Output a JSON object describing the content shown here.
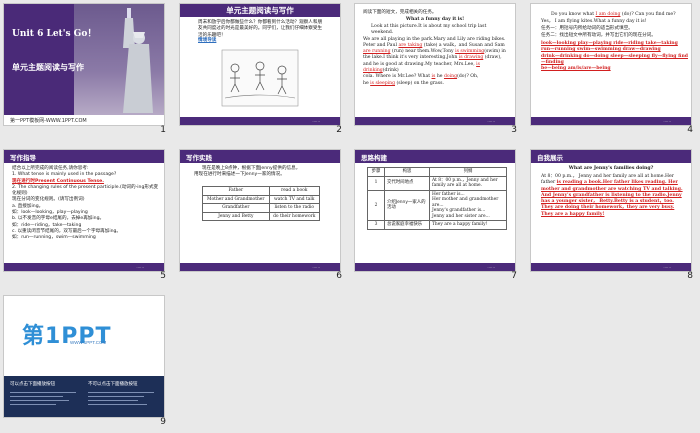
{
  "slide1": {
    "number": "1",
    "unit_title": "Unit 6 Let's Go！",
    "subtitle": "单元主题阅读与写作",
    "footer": "第一PPT模板网-WWW.1PPT.COM"
  },
  "slide2": {
    "number": "2",
    "band": "单元主题阅读与写作",
    "text": "周末和放学后你都做些什么？你都看到什么活动？观察人和朋友共同度过的时光是最美好的。同学们，让我们仔细体察受生活的乐趣吧！",
    "link": "情境导读"
  },
  "slide3": {
    "number": "3",
    "intro": "阅读下面的短文，完成相关的任务。",
    "title": "What a funny day it is!",
    "lines": [
      "Look at this picture.It is about my school trip last weekend.",
      "We are all playing in the park.Mary and Lily are riding bikes.",
      "Peter and Paul",
      "(take) a walk，and Susan and Sam",
      "(run) near them.Wow,Tony",
      "(swim) in",
      "the lake.I think it's very interesting.John",
      "(draw),",
      "and he is good at drawing.My teacher, Mrs.Lee,",
      "(drink)",
      "cola. Where is Mr.Lee? What",
      "he",
      "(do)? Oh,",
      "he",
      "(sleep) on the grass."
    ],
    "answers": [
      "are taking",
      "are running",
      "is swimming",
      "is drawing",
      "is drinking",
      "is",
      "doing",
      "is sleeping"
    ]
  },
  "slide4": {
    "number": "4",
    "q": "Do you know what",
    "ans": "I am doing",
    "q2": "(do)? Can you find me?",
    "l2": "Yes， I am flying kites.What a funny day it is!",
    "tasks": [
      "任务一：用括号内所给动词的适当形式填空。",
      "任务二：找出短文中所有动词，并写出它们的现在分词。"
    ],
    "red_lines": [
      "look—looking play—playing ride—riding take—taking",
      "run—running swim—swimming draw—drawing",
      "drink—drinking do—doing sleep—sleeping fly—flying find—finding",
      "be—being am/is/are—being"
    ]
  },
  "slide5": {
    "number": "5",
    "band": "写作指导",
    "l1": "结合以上所完成的阅读任务,请你思考:",
    "q1": "1. What tense is mainly used in the passage?",
    "a1": "现在进行时Present Continuous Tense.",
    "q2": "2. The changing rules of the present participle.(动词的-ing形式变化规则)",
    "q2b": "现在分词的变化规则。(请写出例词)",
    "r1": "a. 直接加ing。",
    "r1e": "如：look—looking，play—playing",
    "r2": "b. 以不发音的字母e结尾的，去掉e再加ing。",
    "r2e": "如：ride—riding，take—taking",
    "r3": "c. 以重读闭音节结尾的，双写最后一个字母再加ing。",
    "r3e": "如：run—running，swim—swimming"
  },
  "slide6": {
    "number": "6",
    "band": "写作实践",
    "l1": "现在是晚上8点钟，根据下面Jenny提供的信息，",
    "l2": "用现在进行时来描述一下Jenny一家的情况。",
    "rows": [
      [
        "Father",
        "read a book"
      ],
      [
        "Mother and Grandmother",
        "watch TV and talk"
      ],
      [
        "Grandfather",
        "listen to the radio"
      ],
      [
        "Jenny and Betty",
        "do their homework"
      ]
    ]
  },
  "slide7": {
    "number": "7",
    "band": "思路构建",
    "headers": [
      "步骤",
      "构思",
      "列纲"
    ],
    "rows": [
      [
        "1",
        "交代时间地点",
        "At 8：00 p.m.，Jenny and her family are all at home."
      ],
      [
        "2",
        "介绍Jenny一家人的活动",
        "Her father is...\nHer mother and grandmother are...\nJenny's grandfather is...\nJenny and her sister are..."
      ],
      [
        "3",
        "总说家庭幸福快乐",
        "They are a happy family!"
      ]
    ]
  },
  "slide8": {
    "number": "8",
    "band": "自我展示",
    "title": "What are Jenny's families doing?",
    "p1": "At 8：00 p.m.， Jenny and her family are all at home.Her",
    "p2": "father",
    "p3": "is reading a book.Her father likes reading. Her mother and grandmother are watching TV and talking. And Jenny's grandfather is listening to the radio.Jenny has a younger sister， Betty.Betty is a student，too. They are doing their homework，they are very busy. They are a happy family!"
  },
  "slide9": {
    "number": "9",
    "logo": "第1PPT",
    "logo_sub": "WWW.1PPT.COM",
    "col1": "可以点击下面播放按钮",
    "col2": "不可以点击下面播放按钮"
  },
  "colors": {
    "purple": "#4b2a7a",
    "red": "#d21f1f",
    "blue": "#2f6fbe",
    "navy": "#1d2f57"
  }
}
